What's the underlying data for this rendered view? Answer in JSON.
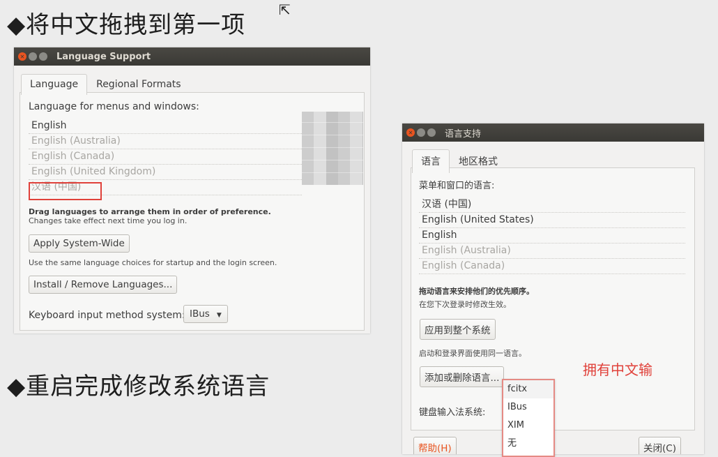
{
  "headings": {
    "step1": "◆将中文拖拽到第一项",
    "step2": "◆重启完成修改系统语言"
  },
  "win_en": {
    "title": "Language Support",
    "tabs": [
      "Language",
      "Regional Formats"
    ],
    "menus_label": "Language for menus and windows:",
    "languages": [
      {
        "name": "English",
        "dim": false
      },
      {
        "name": "English (Australia)",
        "dim": true
      },
      {
        "name": "English (Canada)",
        "dim": true
      },
      {
        "name": "English (United Kingdom)",
        "dim": true
      },
      {
        "name": "汉语 (中国)",
        "dim": true
      }
    ],
    "drag_hint": "Drag languages to arrange them in order of preference.",
    "effect_hint": "Changes take effect next time you log in.",
    "apply_button": "Apply System-Wide",
    "same_choice_hint": "Use the same language choices for startup and the login screen.",
    "install_button": "Install / Remove Languages...",
    "input_method_label": "Keyboard input method system:",
    "input_method_value": "IBus"
  },
  "win_zh": {
    "title": "语言支持",
    "tabs": [
      "语言",
      "地区格式"
    ],
    "menus_label": "菜单和窗口的语言:",
    "languages": [
      {
        "name": "汉语 (中国)",
        "dim": false
      },
      {
        "name": "English (United States)",
        "dim": false
      },
      {
        "name": "English",
        "dim": false
      },
      {
        "name": "English (Australia)",
        "dim": true
      },
      {
        "name": "English (Canada)",
        "dim": true
      }
    ],
    "drag_hint": "拖动语言来安排他们的优先顺序。",
    "effect_hint": "在您下次登录时修改生效。",
    "apply_button": "应用到整个系统",
    "same_choice_hint": "启动和登录界面使用同一语言。",
    "install_button": "添加或删除语言...",
    "input_method_label": "键盘输入法系统:",
    "input_method_options": [
      "fcitx",
      "IBus",
      "XIM",
      "无"
    ],
    "help_button": "帮助(H)",
    "close_button": "关闭(C)"
  },
  "annotation": "拥有中文输",
  "colors": {
    "accent_red": "#e0413a",
    "titlebar": "#3f3e3a",
    "close_orange": "#e95420"
  }
}
